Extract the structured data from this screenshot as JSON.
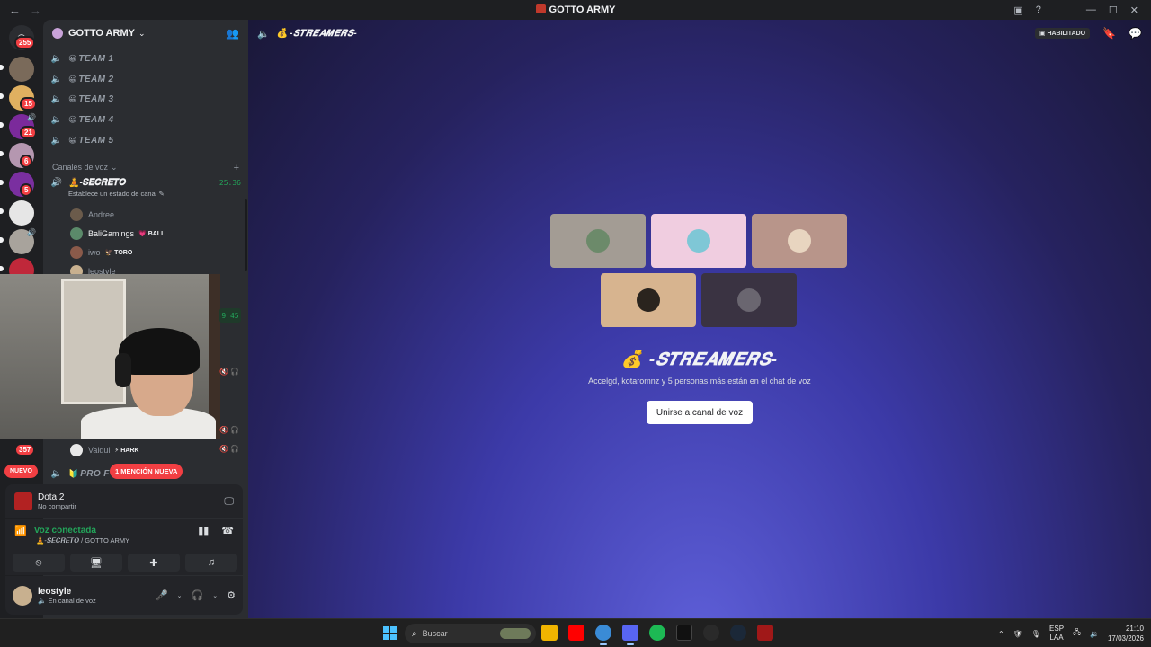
{
  "window": {
    "title": "GOTTO ARMY"
  },
  "rail": {
    "home_badge": "255",
    "servers": [
      {
        "badge": ""
      },
      {
        "badge": "15"
      },
      {
        "badge": "21"
      },
      {
        "badge": "6"
      },
      {
        "badge": "5"
      },
      {
        "badge": ""
      },
      {
        "badge": ""
      },
      {
        "badge": ""
      }
    ],
    "bottom_badge": "357"
  },
  "guild": {
    "name": "GOTTO ARMY"
  },
  "channels": [
    {
      "emoji": "😀",
      "name": "TEAM 1"
    },
    {
      "emoji": "😀",
      "name": "TEAM 2"
    },
    {
      "emoji": "😀",
      "name": "TEAM 3"
    },
    {
      "emoji": "😀",
      "name": "TEAM 4"
    },
    {
      "emoji": "😀",
      "name": "TEAM 5"
    }
  ],
  "voice_category": {
    "label": "Canales de voz"
  },
  "voice_channel": {
    "emoji": "🧘",
    "name": "-𝑺𝑬𝑪𝑹𝑬𝑻𝑶",
    "timer": "25:36",
    "status": "Establece un estado de canal"
  },
  "voice_users": [
    {
      "name": "Andree",
      "tag": ""
    },
    {
      "name": "BaliGamings",
      "tag": "💗 BALI"
    },
    {
      "name": "iwo",
      "tag": "🦅 TORO"
    },
    {
      "name": "leostyle",
      "tag": ""
    }
  ],
  "second_timer": "9:45",
  "valqui": {
    "name": "Valqui",
    "tag": "⚡ HARK"
  },
  "pro_channel": {
    "name": "PRO F"
  },
  "pills": {
    "new": "NUEVO",
    "mention": "1 MENCIÓN NUEVA"
  },
  "activity": {
    "game": "Dota 2",
    "sub": "No compartir"
  },
  "voice_panel": {
    "title": "Voz conectada",
    "sub": "🧘-𝑺𝑬𝑪𝑹𝑬𝑻𝑶 / GOTTO ARMY"
  },
  "user": {
    "name": "leostyle",
    "status": "En canal de voz"
  },
  "main": {
    "channel_title": "-𝑺𝑻𝑹𝑬𝑨𝑴𝑬𝑹𝑺-",
    "enabled_label": "HABILITADO",
    "stage_title": "💰 -𝑺𝑻𝑹𝑬𝑨𝑴𝑬𝑹𝑺-",
    "stage_sub": "Accelgd, kotaromnz y 5 personas más están en el chat de voz",
    "join_button": "Unirse a canal de voz",
    "tile_colors": [
      "#a39c94",
      "#f0cde0",
      "#b8958a",
      "#d7b48f",
      "#3a3342"
    ]
  },
  "taskbar": {
    "search_placeholder": "Buscar",
    "lang1": "ESP",
    "lang2": "LAA",
    "time": "21:10",
    "date": "17/03/2026"
  }
}
